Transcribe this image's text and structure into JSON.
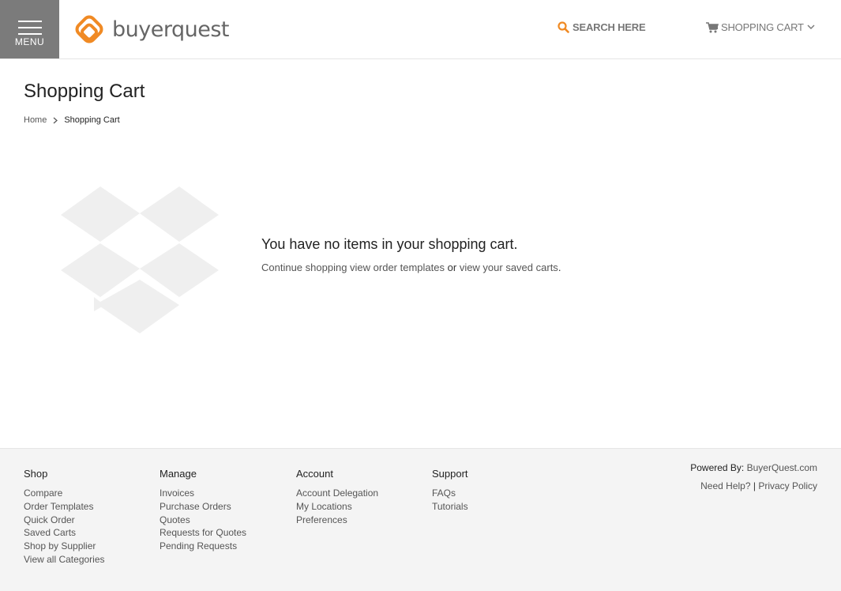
{
  "header": {
    "menu_label": "MENU",
    "logo_text": "buyerquest",
    "search_label": "SEARCH HERE",
    "cart_label": "SHOPPING CART"
  },
  "page": {
    "title": "Shopping Cart",
    "breadcrumb": [
      "Home",
      "Shopping Cart"
    ]
  },
  "empty_cart": {
    "heading": "You have no items in your shopping cart.",
    "continue_link": "Continue shopping",
    "templates_link": "view order templates",
    "or_text": "or",
    "saved_carts_link": "view your saved carts",
    "period": "."
  },
  "footer": {
    "columns": [
      {
        "title": "Shop",
        "links": [
          "Compare",
          "Order Templates",
          "Quick Order",
          "Saved Carts",
          "Shop by Supplier",
          "View all Categories"
        ]
      },
      {
        "title": "Manage",
        "links": [
          "Invoices",
          "Purchase Orders",
          "Quotes",
          "Requests for Quotes",
          "Pending Requests"
        ]
      },
      {
        "title": "Account",
        "links": [
          "Account Delegation",
          "My Locations",
          "Preferences"
        ]
      },
      {
        "title": "Support",
        "links": [
          "FAQs",
          "Tutorials"
        ]
      }
    ],
    "powered_label": "Powered By:",
    "powered_link": "BuyerQuest.com",
    "help_link": "Need Help?",
    "divider": "|",
    "privacy_link": "Privacy Policy"
  },
  "colors": {
    "brand_orange": "#f08a24",
    "menu_bg": "#7b7b7b",
    "footer_bg": "#f4f4f4",
    "box_gray": "#efefef"
  },
  "icons": {
    "menu": "hamburger-icon",
    "logo": "buyerquest-logo-icon",
    "search": "search-icon",
    "cart": "cart-icon",
    "chevron": "chevron-down-icon",
    "breadcrumb_sep": "chevron-right-icon",
    "empty": "open-box-icon"
  }
}
